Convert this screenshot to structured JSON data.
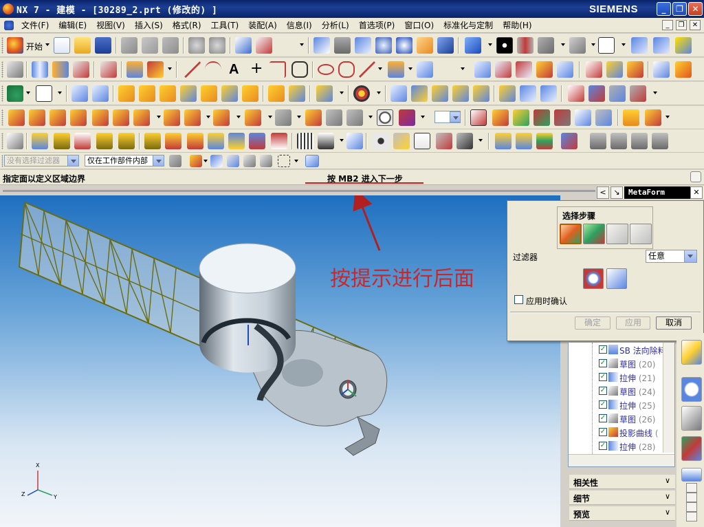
{
  "window": {
    "title": "NX 7 - 建模 - [30289_2.prt  (修改的) ]",
    "brand": "SIEMENS",
    "btn_min": "_",
    "btn_max": "❐",
    "btn_close": "✕"
  },
  "menu": {
    "items": [
      "文件(F)",
      "编辑(E)",
      "视图(V)",
      "插入(S)",
      "格式(R)",
      "工具(T)",
      "装配(A)",
      "信息(I)",
      "分析(L)",
      "首选项(P)",
      "窗口(O)",
      "标准化与定制",
      "帮助(H)"
    ],
    "mdi_min": "_",
    "mdi_restore": "❐",
    "mdi_close": "✕"
  },
  "toolbar": {
    "start_label": "开始",
    "text_tool": "A",
    "point_tool": "+"
  },
  "selection_bar": {
    "type_filter": "没有选择过滤器",
    "scope": "仅在工作部件内部"
  },
  "cue_line": {
    "cue": "指定面以定义区域边界",
    "status": "按 MB2 进入下一步"
  },
  "viewport": {
    "annotation": "按提示进行后面",
    "triad_labels": {
      "x": "X",
      "y": "Y",
      "z": "Z"
    }
  },
  "metaform": {
    "title": "MetaForm",
    "back": "<",
    "pin": "↘",
    "close": "✕"
  },
  "dialog": {
    "steps_title": "选择步骤",
    "filter_label": "过滤器",
    "filter_value": "任意",
    "confirm_label": "应用时确认",
    "ok": "确定",
    "apply": "应用",
    "cancel": "取消",
    "active_step": 1
  },
  "navigator": {
    "rows": [
      {
        "label": "SB 法向除料",
        "num": ""
      },
      {
        "label": "草图",
        "num": "(20)"
      },
      {
        "label": "拉伸",
        "num": "(21)"
      },
      {
        "label": "草图",
        "num": "(24)"
      },
      {
        "label": "拉伸",
        "num": "(25)"
      },
      {
        "label": "草图",
        "num": "(26)"
      },
      {
        "label": "投影曲线",
        "num": "("
      },
      {
        "label": "拉伸",
        "num": "(28)"
      }
    ],
    "check_mark": "✓"
  },
  "panels": {
    "dependencies": "相关性",
    "details": "细节",
    "preview": "预览",
    "chevron": "∨"
  },
  "colors": {
    "title_bar": "#0a246a",
    "viewport_top": "#1e6fc0",
    "annotation": "#c8282c",
    "wireframe": "#6b6b10"
  }
}
